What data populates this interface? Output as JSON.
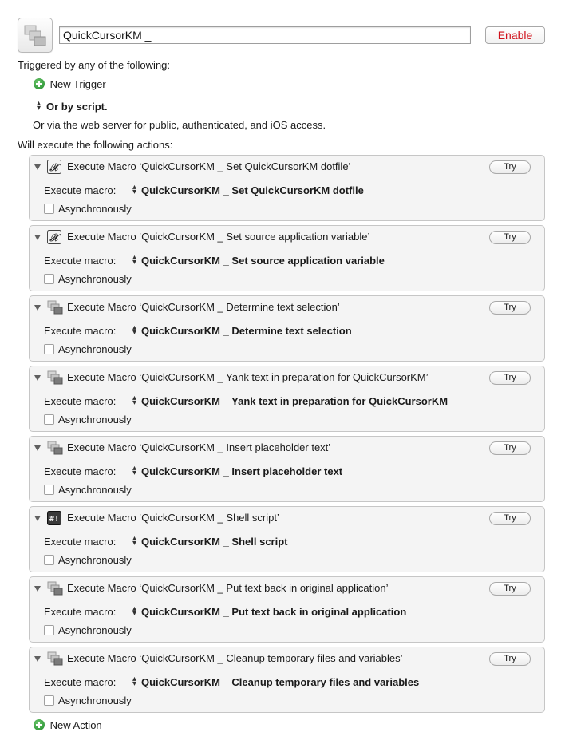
{
  "macro": {
    "name": "QuickCursorKM _",
    "enable_label": "Enable"
  },
  "triggers": {
    "heading": "Triggered by any of the following:",
    "new_trigger_label": "New Trigger",
    "or_by_script_label": "Or by script.",
    "web_server_note": "Or via the web server for public, authenticated, and iOS access."
  },
  "actions_heading": "Will execute the following actions:",
  "exec_label": "Execute macro:",
  "async_label": "Asynchronously",
  "try_label": "Try",
  "actions": [
    {
      "icon": "variable-x-icon",
      "title": "Execute Macro ‘QuickCursorKM _ Set QuickCursorKM dotfile’",
      "value": "QuickCursorKM _ Set QuickCursorKM dotfile"
    },
    {
      "icon": "variable-x-icon",
      "title": "Execute Macro ‘QuickCursorKM _ Set source application variable’",
      "value": "QuickCursorKM _ Set source application variable"
    },
    {
      "icon": "macro-windows-icon",
      "title": "Execute Macro ‘QuickCursorKM _ Determine text selection’",
      "value": "QuickCursorKM _ Determine text selection"
    },
    {
      "icon": "macro-windows-icon",
      "title": "Execute Macro ‘QuickCursorKM _ Yank text in preparation for QuickCursorKM’",
      "value": "QuickCursorKM _ Yank text in preparation for QuickCursorKM"
    },
    {
      "icon": "macro-windows-icon",
      "title": "Execute Macro ‘QuickCursorKM _ Insert placeholder text’",
      "value": "QuickCursorKM _ Insert placeholder text"
    },
    {
      "icon": "shell-script-icon",
      "title": "Execute Macro ‘QuickCursorKM _ Shell script’",
      "value": "QuickCursorKM _ Shell script"
    },
    {
      "icon": "macro-windows-icon",
      "title": "Execute Macro ‘QuickCursorKM _ Put text back in original application’",
      "value": "QuickCursorKM _ Put text back in original application"
    },
    {
      "icon": "macro-windows-icon",
      "title": "Execute Macro ‘QuickCursorKM _ Cleanup temporary files and variables’",
      "value": "QuickCursorKM _ Cleanup temporary files and variables"
    }
  ],
  "new_action_label": "New Action",
  "shell_icon_glyph": "#!",
  "variable_icon_glyph": "𝒳"
}
